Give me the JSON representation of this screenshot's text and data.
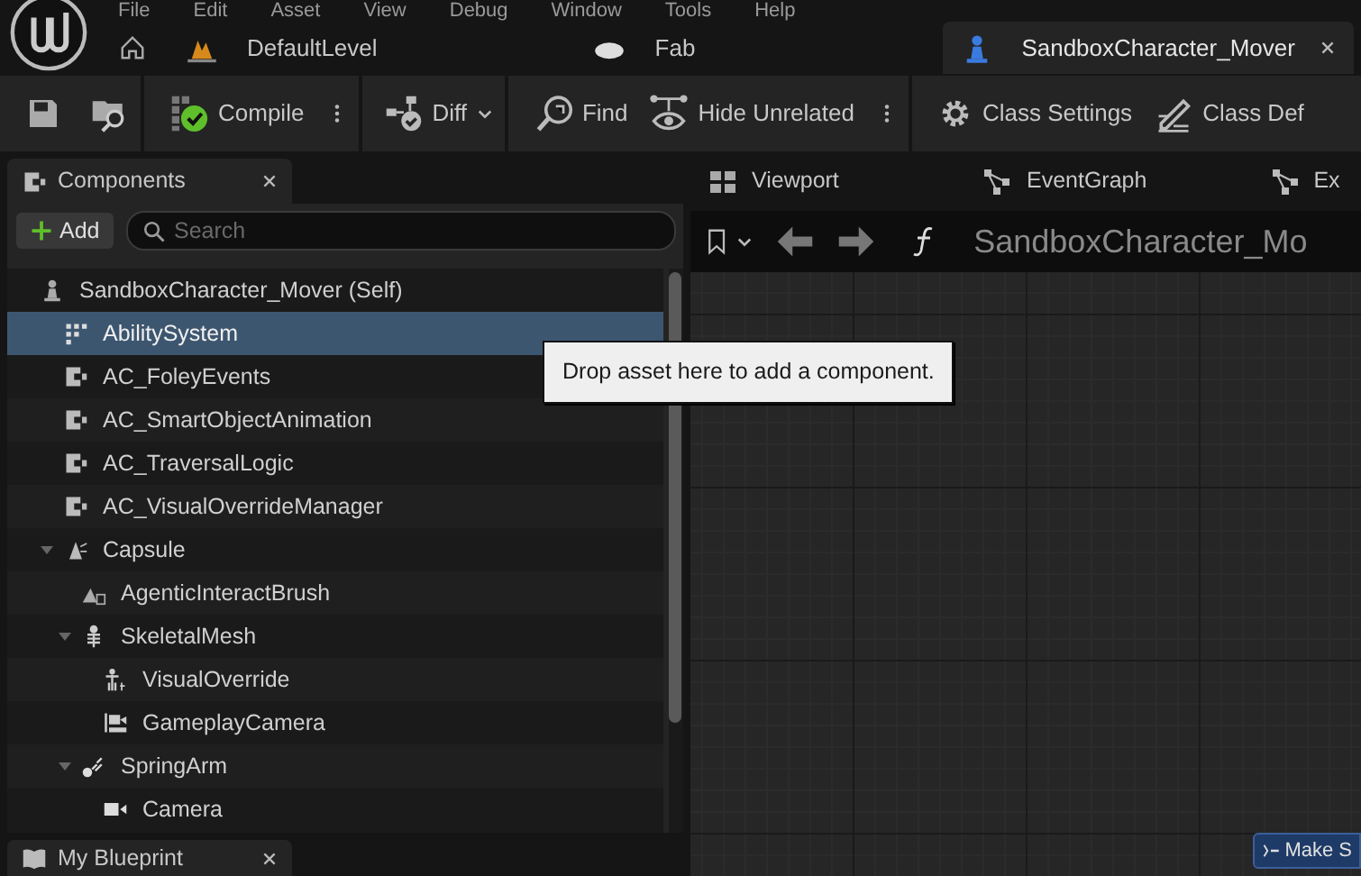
{
  "menu": [
    "File",
    "Edit",
    "Asset",
    "View",
    "Debug",
    "Window",
    "Tools",
    "Help"
  ],
  "document_tabs": [
    {
      "label": "DefaultLevel",
      "kind": "level",
      "selected": false
    },
    {
      "label": "Fab",
      "kind": "fab",
      "selected": false
    },
    {
      "label": "SandboxCharacter_Mover",
      "kind": "blueprint",
      "selected": true
    }
  ],
  "toolbar": {
    "compile": "Compile",
    "diff": "Diff",
    "find": "Find",
    "hide_unrelated": "Hide Unrelated",
    "class_settings": "Class Settings",
    "class_defaults": "Class Def"
  },
  "components_panel": {
    "title": "Components",
    "add_button": "Add",
    "search": {
      "placeholder": "Search"
    },
    "tree": [
      {
        "label": "SandboxCharacter_Mover (Self)",
        "kind": "actor",
        "selected": false,
        "children": [
          {
            "label": "AbilitySystem",
            "kind": "ability",
            "selected": true
          },
          {
            "label": "AC_FoleyEvents",
            "kind": "script",
            "selected": false
          },
          {
            "label": "AC_SmartObjectAnimation",
            "kind": "script",
            "selected": false
          },
          {
            "label": "AC_TraversalLogic",
            "kind": "script",
            "selected": false
          },
          {
            "label": "AC_VisualOverrideManager",
            "kind": "script",
            "selected": false
          },
          {
            "label": "Capsule",
            "kind": "capsule",
            "selected": false,
            "expanded": true,
            "children": [
              {
                "label": "AgenticInteractBrush",
                "kind": "brush",
                "selected": false
              },
              {
                "label": "SkeletalMesh",
                "kind": "skeleton",
                "selected": false,
                "expanded": true,
                "children": [
                  {
                    "label": "VisualOverride",
                    "kind": "child_actor",
                    "selected": false
                  },
                  {
                    "label": "GameplayCamera",
                    "kind": "camera_rig",
                    "selected": false
                  }
                ]
              },
              {
                "label": "SpringArm",
                "kind": "spring_arm",
                "selected": false,
                "expanded": true,
                "children": [
                  {
                    "label": "Camera",
                    "kind": "camera",
                    "selected": false
                  }
                ]
              }
            ]
          }
        ]
      }
    ]
  },
  "tooltip": "Drop asset here to add a component.",
  "bottom_panel": {
    "title": "My Blueprint"
  },
  "graph_tabs": [
    "Viewport",
    "EventGraph",
    "Ex"
  ],
  "graph": {
    "title": "SandboxCharacter_Mo",
    "action_button": "Make S"
  }
}
